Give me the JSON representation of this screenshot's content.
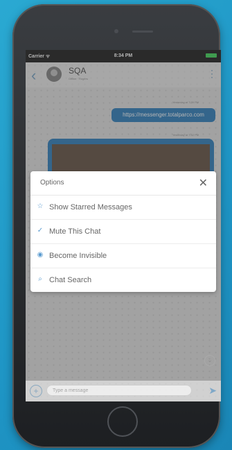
{
  "status": {
    "carrier": "Carrier ᯤ",
    "time": "8:34 PM"
  },
  "chat": {
    "name": "SQA",
    "subtitle": "Offline · Rogers"
  },
  "messages": [
    {
      "meta": "Yesterday at 7:39 PM",
      "text": "https://messenger.totalparco.com"
    },
    {
      "meta": "Yesterday at 7:52 PM",
      "text": ""
    }
  ],
  "dialog": {
    "title": "Options",
    "close_icon": "close-icon",
    "options": [
      {
        "icon": "star-icon",
        "label": "Show Starred Messages"
      },
      {
        "icon": "check-icon",
        "label": "Mute This Chat"
      },
      {
        "icon": "eye-icon",
        "label": "Become Invisible"
      },
      {
        "icon": "search-icon",
        "label": "Chat Search"
      }
    ]
  },
  "composer": {
    "placeholder": "Type a message"
  },
  "colors": {
    "accent": "#3b86c1",
    "background": "#2aa9d2"
  }
}
